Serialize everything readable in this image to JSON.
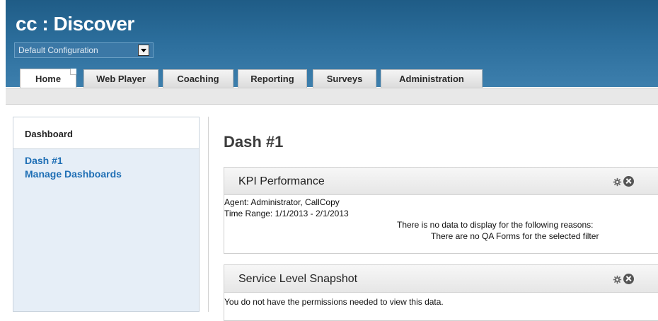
{
  "header": {
    "logo": "cc : Discover",
    "configuration": "Default Configuration"
  },
  "tabs": [
    "Home",
    "Web Player",
    "Coaching",
    "Reporting",
    "Surveys",
    "Administration"
  ],
  "sidebar": {
    "title": "Dashboard",
    "links": [
      "Dash #1",
      "Manage Dashboards"
    ]
  },
  "main": {
    "title": "Dash #1",
    "panels": [
      {
        "title": "KPI Performance",
        "lines": [
          "Agent: Administrator, CallCopy",
          "Time Range: 1/1/2013 - 2/1/2013",
          "There is no data to display for the following reasons:",
          "There are no QA Forms for the selected filter"
        ]
      },
      {
        "title": "Service Level Snapshot",
        "lines": [
          "You do not have the permissions needed to view this data."
        ]
      }
    ]
  },
  "icons": [
    "gear-icon",
    "close-icon",
    "dropdown-arrow-icon"
  ],
  "colors": {
    "header_blue": "#2b6d9b",
    "link_blue": "#1f6fb5",
    "sidebar_bg": "#e6eef7"
  }
}
